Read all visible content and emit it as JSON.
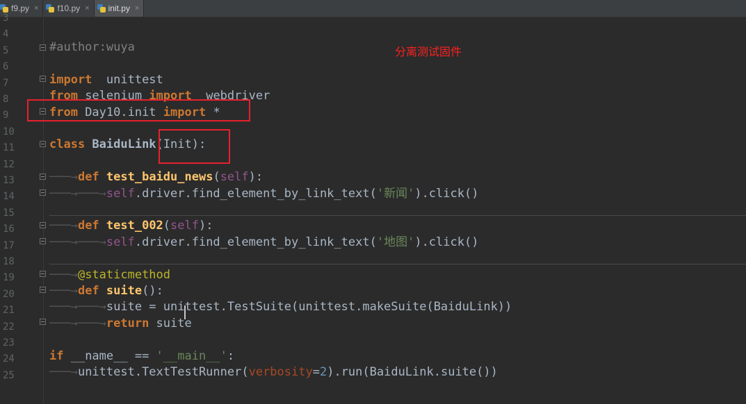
{
  "tabs": [
    {
      "label": "f9.py",
      "icon": "python-file-icon",
      "active": false
    },
    {
      "label": "f10.py",
      "icon": "python-file-icon",
      "active": false
    },
    {
      "label": "init.py",
      "icon": "python-file-icon",
      "active": true
    }
  ],
  "tab_close_glyph": "×",
  "line_numbers": [
    "3",
    "4",
    "5",
    "6",
    "7",
    "8",
    "9",
    "10",
    "11",
    "12",
    "13",
    "14",
    "15",
    "16",
    "17",
    "18",
    "19",
    "20",
    "21",
    "22",
    "23",
    "24",
    "25"
  ],
  "annotation": "分离测试固件",
  "code": {
    "l4": {
      "comment": "#author:wuya"
    },
    "l6": {
      "kw": "import",
      "rest": "  unittest"
    },
    "l7": {
      "kw1": "from",
      "mod": " selenium ",
      "kw2": "import",
      "rest": "  webdriver"
    },
    "l8": {
      "kw1": "from",
      "mod": " Day10.init ",
      "kw2": "import",
      "rest": " *"
    },
    "l10": {
      "kw": "class",
      "name": " BaiduLink",
      "open": "(",
      "base": "Init",
      "close": "):"
    },
    "l12": {
      "kw": "def",
      "name": " test_baidu_news",
      "open": "(",
      "self": "self",
      "close": "):"
    },
    "l13": {
      "self": "self",
      "call": ".driver.find_element_by_link_text(",
      "str": "'新闻'",
      "tail": ").click()"
    },
    "l15": {
      "kw": "def",
      "name": " test_002",
      "open": "(",
      "self": "self",
      "close": "):"
    },
    "l16": {
      "self": "self",
      "call": ".driver.find_element_by_link_text(",
      "str": "'地图'",
      "tail": ").click()"
    },
    "l18": {
      "deco": "@staticmethod"
    },
    "l19": {
      "kw": "def",
      "name": " suite",
      "rest": "():"
    },
    "l20": {
      "text": "suite = unittest.TestSuite(unittest.makeSuite(BaiduLink))"
    },
    "l21": {
      "kw": "return",
      "rest": " suite"
    },
    "l23": {
      "kw": "if",
      "mid": " __name__ == ",
      "str": "'__main__'",
      "rest": ":"
    },
    "l24": {
      "call": "unittest.TextTestRunner(",
      "param": "verbosity",
      "eq": "=",
      "num": "2",
      "tail": ").run(BaiduLink.suite())"
    }
  }
}
